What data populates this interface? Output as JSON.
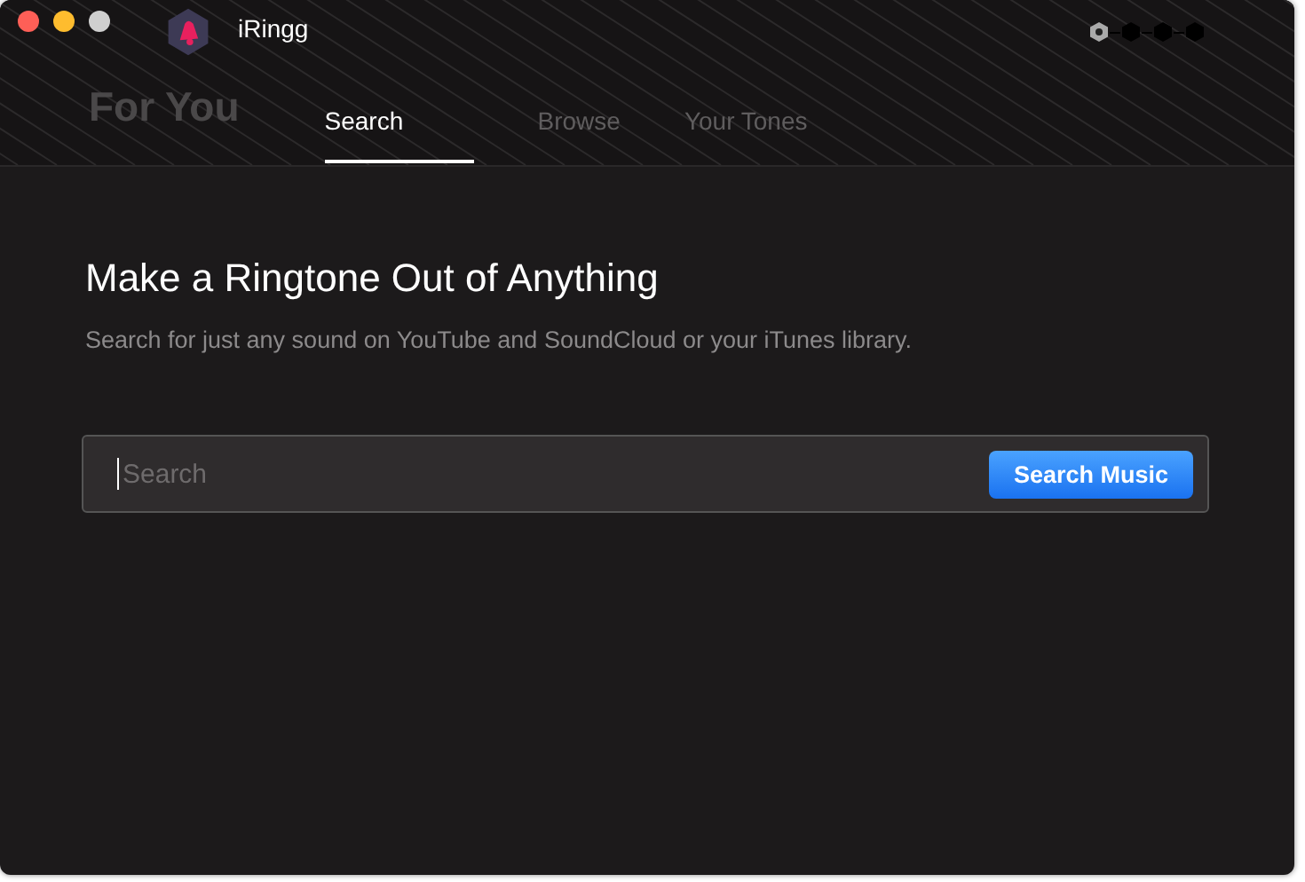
{
  "window": {
    "title": "iRingg"
  },
  "steps": [
    {
      "selected": true
    },
    {
      "selected": false
    },
    {
      "selected": false
    },
    {
      "selected": false
    }
  ],
  "tabs": [
    {
      "label": "For You",
      "kind": "heading",
      "selected": false
    },
    {
      "label": "Search",
      "kind": "tab",
      "selected": true
    },
    {
      "label": "Browse",
      "kind": "tab",
      "selected": false
    },
    {
      "label": "Your Tones",
      "kind": "tab",
      "selected": false
    }
  ],
  "heading": "Make a Ringtone Out of Anything",
  "subtitle": "Search for just any sound on YouTube and SoundCloud or your iTunes library.",
  "search": {
    "placeholder": "Search",
    "button": "Search Music"
  }
}
